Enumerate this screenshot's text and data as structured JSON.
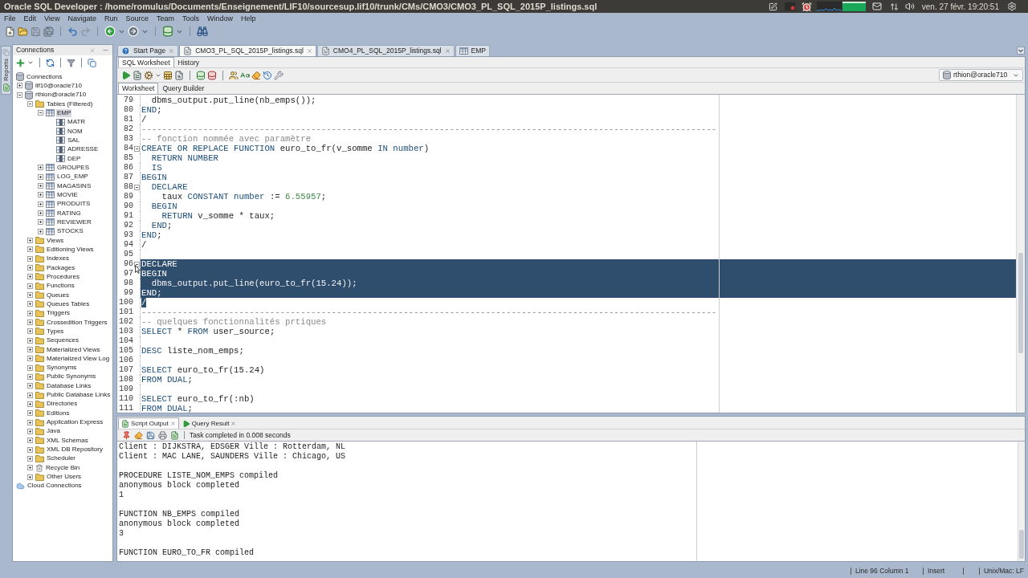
{
  "top_bar": {
    "title": "Oracle SQL Developer : /home/romulus/Documents/Enseignement/LIF10/sourcesup.lif10/trunk/CMs/CMO3/CMO3_PL_SQL_2015P_listings.sql",
    "clock": "ven. 27 févr. 19:20:51"
  },
  "menu": [
    "File",
    "Edit",
    "View",
    "Navigate",
    "Run",
    "Source",
    "Team",
    "Tools",
    "Window",
    "Help"
  ],
  "side_strip": {
    "label": "Reports"
  },
  "sidebar": {
    "title": "Connections",
    "tree": [
      {
        "label": "Connections",
        "kind": "connections",
        "selected": false,
        "children": [
          {
            "label": "lif10@oracle710",
            "kind": "connection",
            "expanded": false,
            "selected": false
          },
          {
            "label": "rthion@oracle710",
            "kind": "connection",
            "expanded": true,
            "selected": false,
            "children": [
              {
                "label": "Tables (Filtered)",
                "kind": "folder",
                "expanded": true,
                "selected": false,
                "children": [
                  {
                    "label": "EMP",
                    "kind": "table",
                    "expanded": true,
                    "selected": true,
                    "children": [
                      {
                        "label": "MATR",
                        "kind": "column",
                        "selected": false
                      },
                      {
                        "label": "NOM",
                        "kind": "column",
                        "selected": false
                      },
                      {
                        "label": "SAL",
                        "kind": "column",
                        "selected": false
                      },
                      {
                        "label": "ADRESSE",
                        "kind": "column",
                        "selected": false
                      },
                      {
                        "label": "DEP",
                        "kind": "column",
                        "selected": false
                      }
                    ]
                  },
                  {
                    "label": "GROUPES",
                    "kind": "table",
                    "expanded": false,
                    "selected": false
                  },
                  {
                    "label": "LOG_EMP",
                    "kind": "table",
                    "expanded": false,
                    "selected": false
                  },
                  {
                    "label": "MAGASINS",
                    "kind": "table",
                    "expanded": false,
                    "selected": false
                  },
                  {
                    "label": "MOVIE",
                    "kind": "table",
                    "expanded": false,
                    "selected": false
                  },
                  {
                    "label": "PRODUITS",
                    "kind": "table",
                    "expanded": false,
                    "selected": false
                  },
                  {
                    "label": "RATING",
                    "kind": "table",
                    "expanded": false,
                    "selected": false
                  },
                  {
                    "label": "REVIEWER",
                    "kind": "table",
                    "expanded": false,
                    "selected": false
                  },
                  {
                    "label": "STOCKS",
                    "kind": "table",
                    "expanded": false,
                    "selected": false
                  }
                ]
              },
              {
                "label": "Views",
                "kind": "folder",
                "expanded": false,
                "selected": false
              },
              {
                "label": "Editioning Views",
                "kind": "folder",
                "expanded": false,
                "selected": false
              },
              {
                "label": "Indexes",
                "kind": "folder",
                "expanded": false,
                "selected": false
              },
              {
                "label": "Packages",
                "kind": "folder",
                "expanded": false,
                "selected": false
              },
              {
                "label": "Procedures",
                "kind": "folder",
                "expanded": false,
                "selected": false
              },
              {
                "label": "Functions",
                "kind": "folder",
                "expanded": false,
                "selected": false
              },
              {
                "label": "Queues",
                "kind": "folder",
                "expanded": false,
                "selected": false
              },
              {
                "label": "Queues Tables",
                "kind": "folder",
                "expanded": false,
                "selected": false
              },
              {
                "label": "Triggers",
                "kind": "folder",
                "expanded": false,
                "selected": false
              },
              {
                "label": "Crossedition Triggers",
                "kind": "folder",
                "expanded": false,
                "selected": false
              },
              {
                "label": "Types",
                "kind": "folder",
                "expanded": false,
                "selected": false
              },
              {
                "label": "Sequences",
                "kind": "folder",
                "expanded": false,
                "selected": false
              },
              {
                "label": "Materialized Views",
                "kind": "folder",
                "expanded": false,
                "selected": false
              },
              {
                "label": "Materialized View Log",
                "kind": "folder",
                "expanded": false,
                "selected": false
              },
              {
                "label": "Synonyms",
                "kind": "folder",
                "expanded": false,
                "selected": false
              },
              {
                "label": "Public Synonyms",
                "kind": "folder",
                "expanded": false,
                "selected": false
              },
              {
                "label": "Database Links",
                "kind": "folder",
                "expanded": false,
                "selected": false
              },
              {
                "label": "Public Database Links",
                "kind": "folder",
                "expanded": false,
                "selected": false
              },
              {
                "label": "Directories",
                "kind": "folder",
                "expanded": false,
                "selected": false
              },
              {
                "label": "Editions",
                "kind": "folder",
                "expanded": false,
                "selected": false
              },
              {
                "label": "Application Express",
                "kind": "folder",
                "expanded": false,
                "selected": false
              },
              {
                "label": "Java",
                "kind": "folder",
                "expanded": false,
                "selected": false
              },
              {
                "label": "XML Schemas",
                "kind": "folder",
                "expanded": false,
                "selected": false
              },
              {
                "label": "XML DB Repository",
                "kind": "folder",
                "expanded": false,
                "selected": false
              },
              {
                "label": "Scheduler",
                "kind": "folder",
                "expanded": false,
                "selected": false
              },
              {
                "label": "Recycle Bin",
                "kind": "bin",
                "expanded": false,
                "selected": false
              },
              {
                "label": "Other Users",
                "kind": "folder",
                "expanded": false,
                "selected": false
              }
            ]
          }
        ]
      },
      {
        "label": "Cloud Connections",
        "kind": "cloud",
        "selected": false
      }
    ]
  },
  "editor_tabs": [
    {
      "label": "Start Page",
      "kind": "start",
      "selected": false,
      "closable": true
    },
    {
      "label": "CMO3_PL_SQL_2015P_listings.sql",
      "kind": "sql",
      "selected": true,
      "closable": true
    },
    {
      "label": "CMO4_PL_SQL_2015P_listings.sql",
      "kind": "sql",
      "selected": false,
      "closable": true
    },
    {
      "label": "EMP",
      "kind": "table",
      "selected": false,
      "closable": false
    }
  ],
  "worksheet_tabs": [
    {
      "label": "SQL Worksheet",
      "selected": true
    },
    {
      "label": "History",
      "selected": false
    }
  ],
  "connection_selector": {
    "value": "rthion@oracle710"
  },
  "editor_mode_tabs": [
    {
      "label": "Worksheet",
      "selected": true
    },
    {
      "label": "Query Builder",
      "selected": false
    }
  ],
  "code_lines": [
    {
      "number": "79",
      "segments": [
        {
          "kind": "id",
          "text": "  dbms_output.put_line(nb_emps());"
        }
      ],
      "selected": false,
      "fold": false
    },
    {
      "number": "80",
      "segments": [
        {
          "kind": "kw",
          "text": "END"
        },
        {
          "kind": "id",
          "text": ";"
        }
      ],
      "selected": false,
      "fold": false
    },
    {
      "number": "81",
      "segments": [
        {
          "kind": "id",
          "text": "/"
        }
      ],
      "selected": false,
      "fold": false
    },
    {
      "number": "82",
      "segments": [
        {
          "kind": "comment",
          "text": "----------------------------------------------------------------------------------------------------------------"
        }
      ],
      "selected": false,
      "fold": false
    },
    {
      "number": "83",
      "segments": [
        {
          "kind": "comment",
          "text": "-- fonction nommée avec paramètre"
        }
      ],
      "selected": false,
      "fold": false
    },
    {
      "number": "84",
      "segments": [
        {
          "kind": "kw",
          "text": "CREATE OR REPLACE FUNCTION"
        },
        {
          "kind": "id",
          "text": " euro_to_fr(v_somme "
        },
        {
          "kind": "kw",
          "text": "IN number"
        },
        {
          "kind": "id",
          "text": ")"
        }
      ],
      "selected": false,
      "fold": true
    },
    {
      "number": "85",
      "segments": [
        {
          "kind": "kw",
          "text": "  RETURN NUMBER"
        }
      ],
      "selected": false,
      "fold": false
    },
    {
      "number": "86",
      "segments": [
        {
          "kind": "kw",
          "text": "  IS"
        }
      ],
      "selected": false,
      "fold": false
    },
    {
      "number": "87",
      "segments": [
        {
          "kind": "kw",
          "text": "BEGIN"
        }
      ],
      "selected": false,
      "fold": false
    },
    {
      "number": "88",
      "segments": [
        {
          "kind": "kw",
          "text": "  DECLARE"
        }
      ],
      "selected": false,
      "fold": true
    },
    {
      "number": "89",
      "segments": [
        {
          "kind": "id",
          "text": "    taux "
        },
        {
          "kind": "kw",
          "text": "CONSTANT number"
        },
        {
          "kind": "id",
          "text": " := "
        },
        {
          "kind": "num",
          "text": "6.55957"
        },
        {
          "kind": "id",
          "text": ";"
        }
      ],
      "selected": false,
      "fold": false
    },
    {
      "number": "90",
      "segments": [
        {
          "kind": "kw",
          "text": "  BEGIN"
        }
      ],
      "selected": false,
      "fold": false
    },
    {
      "number": "91",
      "segments": [
        {
          "kind": "kw",
          "text": "    RETURN"
        },
        {
          "kind": "id",
          "text": " v_somme * taux;"
        }
      ],
      "selected": false,
      "fold": false
    },
    {
      "number": "92",
      "segments": [
        {
          "kind": "kw",
          "text": "  END"
        },
        {
          "kind": "id",
          "text": ";"
        }
      ],
      "selected": false,
      "fold": false
    },
    {
      "number": "93",
      "segments": [
        {
          "kind": "kw",
          "text": "END"
        },
        {
          "kind": "id",
          "text": ";"
        }
      ],
      "selected": false,
      "fold": false
    },
    {
      "number": "94",
      "segments": [
        {
          "kind": "id",
          "text": "/"
        }
      ],
      "selected": false,
      "fold": false
    },
    {
      "number": "95",
      "selected": false,
      "fold": false
    },
    {
      "number": "96",
      "segments": [
        {
          "kind": "kw",
          "text": "DECLARE"
        }
      ],
      "selected": true,
      "fold": true
    },
    {
      "number": "97",
      "segments": [
        {
          "kind": "kw",
          "text": "BEGIN"
        }
      ],
      "selected": true,
      "fold": false
    },
    {
      "number": "98",
      "segments": [
        {
          "kind": "id",
          "text": "  dbms_output.put_line(euro_to_fr(15.24));"
        }
      ],
      "selected": true,
      "fold": false
    },
    {
      "number": "99",
      "segments": [
        {
          "kind": "kw",
          "text": "END"
        },
        {
          "kind": "id",
          "text": ";"
        }
      ],
      "selected": true,
      "fold": false
    },
    {
      "number": "100",
      "segments": [
        {
          "kind": "id",
          "text": "/"
        }
      ],
      "selected": true,
      "fold": false
    },
    {
      "number": "101",
      "segments": [
        {
          "kind": "comment",
          "text": "----------------------------------------------------------------------------------------------------------------"
        }
      ],
      "selected": false,
      "fold": false
    },
    {
      "number": "102",
      "segments": [
        {
          "kind": "comment",
          "text": "-- quelques fonctionnalités prtiques"
        }
      ],
      "selected": false,
      "fold": false
    },
    {
      "number": "103",
      "segments": [
        {
          "kind": "kw",
          "text": "SELECT"
        },
        {
          "kind": "id",
          "text": " * "
        },
        {
          "kind": "kw",
          "text": "FROM"
        },
        {
          "kind": "id",
          "text": " user_source;"
        }
      ],
      "selected": false,
      "fold": false
    },
    {
      "number": "104",
      "selected": false,
      "fold": false
    },
    {
      "number": "105",
      "segments": [
        {
          "kind": "kw",
          "text": "DESC"
        },
        {
          "kind": "id",
          "text": " liste_nom_emps;"
        }
      ],
      "selected": false,
      "fold": false
    },
    {
      "number": "106",
      "selected": false,
      "fold": false
    },
    {
      "number": "107",
      "segments": [
        {
          "kind": "kw",
          "text": "SELECT"
        },
        {
          "kind": "id",
          "text": " euro_to_fr(15.24)"
        }
      ],
      "selected": false,
      "fold": false
    },
    {
      "number": "108",
      "segments": [
        {
          "kind": "kw",
          "text": "FROM DUAL"
        },
        {
          "kind": "id",
          "text": ";"
        }
      ],
      "selected": false,
      "fold": false
    },
    {
      "number": "109",
      "selected": false,
      "fold": false
    },
    {
      "number": "110",
      "segments": [
        {
          "kind": "kw",
          "text": "SELECT"
        },
        {
          "kind": "id",
          "text": " euro_to_fr(:nb)"
        }
      ],
      "selected": false,
      "fold": false
    },
    {
      "number": "111",
      "segments": [
        {
          "kind": "kw",
          "text": "FROM DUAL"
        },
        {
          "kind": "id",
          "text": ";"
        }
      ],
      "selected": false,
      "fold": false
    }
  ],
  "output_tabs": [
    {
      "label": "Script Output",
      "kind": "script",
      "selected": true
    },
    {
      "label": "Query Result",
      "kind": "query",
      "selected": false
    }
  ],
  "output_status": "Task completed in 0.008 seconds",
  "output_blocks": [
    [
      "Client : DIJKSTRA, EDSGER Ville : Rotterdam, NL",
      "Client : MAC LANE, SAUNDERS Ville : Chicago, US"
    ],
    [
      "PROCEDURE LISTE_NOM_EMPS compiled",
      "anonymous block completed",
      "1"
    ],
    [
      "FUNCTION NB_EMPS compiled",
      "anonymous block completed",
      "3"
    ],
    [
      "FUNCTION EURO_TO_FR compiled"
    ]
  ],
  "status_bar": {
    "position": "Line 96 Column 1",
    "mode": "Insert",
    "line_endings": "Unix/Mac: LF"
  }
}
